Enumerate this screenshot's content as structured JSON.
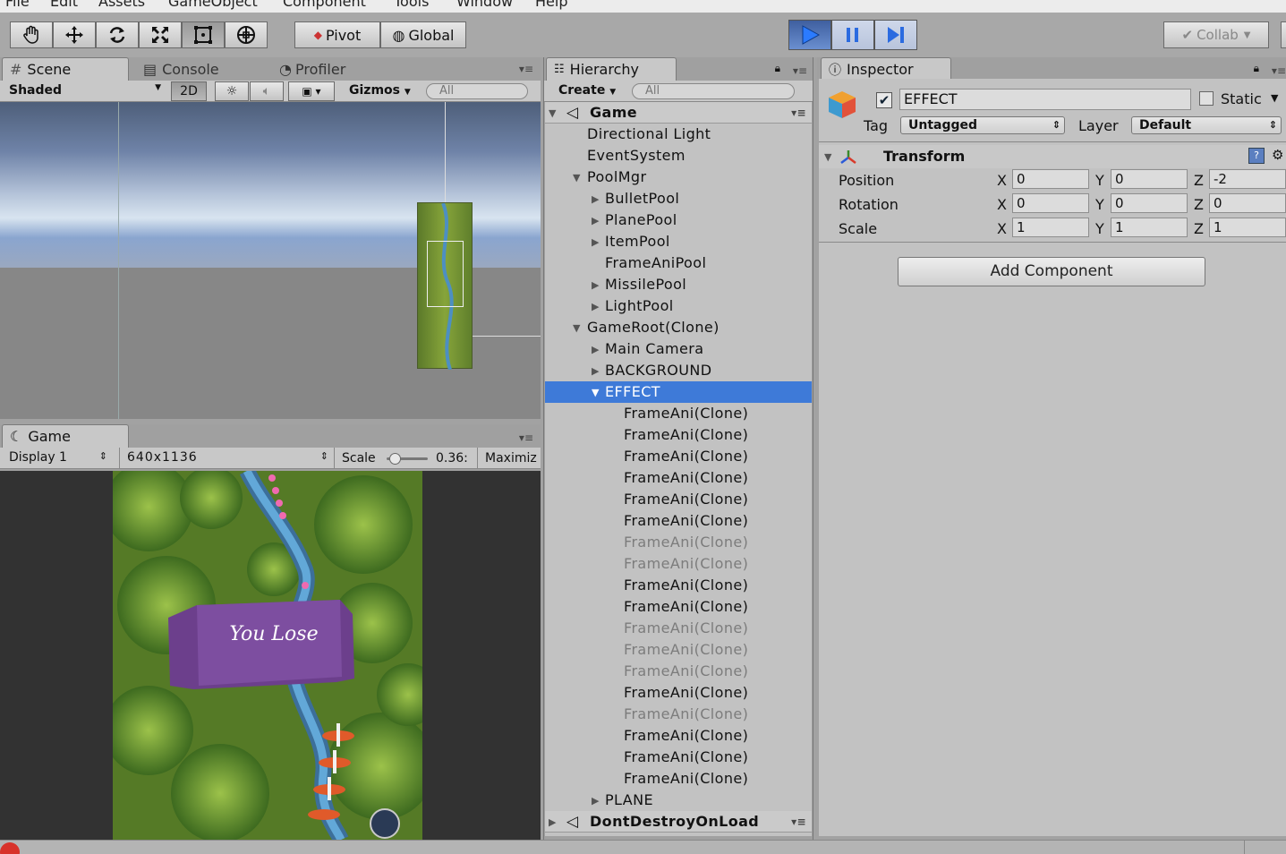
{
  "menu": [
    "File",
    "Edit",
    "Assets",
    "GameObject",
    "Component",
    "Tools",
    "Window",
    "Help"
  ],
  "toolbar": {
    "tools": [
      "hand-icon",
      "move-icon",
      "rotate-icon",
      "scale-icon",
      "rect-icon",
      "transform-icon"
    ],
    "pivot_label": "Pivot",
    "global_label": "Global",
    "collab_label": "Collab"
  },
  "scene_panel": {
    "tabs": [
      "Scene",
      "Console",
      "Profiler"
    ],
    "shading": "Shaded",
    "mode_2d": "2D",
    "gizmos": "Gizmos",
    "search_placeholder": "All"
  },
  "game_panel": {
    "tab": "Game",
    "display": "Display 1",
    "resolution": "640x1136",
    "scale_label": "Scale",
    "scale_value": "0.36:",
    "maximize": "Maximiz",
    "banner_text": "You Lose"
  },
  "hierarchy": {
    "tab": "Hierarchy",
    "create": "Create",
    "search_placeholder": "All",
    "rows": [
      {
        "label": "Game",
        "depth": 0,
        "tri": "down",
        "kind": "scene"
      },
      {
        "label": "Directional Light",
        "depth": 1,
        "tri": ""
      },
      {
        "label": "EventSystem",
        "depth": 1,
        "tri": ""
      },
      {
        "label": "PoolMgr",
        "depth": 1,
        "tri": "down"
      },
      {
        "label": "BulletPool",
        "depth": 2,
        "tri": "right"
      },
      {
        "label": "PlanePool",
        "depth": 2,
        "tri": "right"
      },
      {
        "label": "ItemPool",
        "depth": 2,
        "tri": "right"
      },
      {
        "label": "FrameAniPool",
        "depth": 2,
        "tri": ""
      },
      {
        "label": "MissilePool",
        "depth": 2,
        "tri": "right"
      },
      {
        "label": "LightPool",
        "depth": 2,
        "tri": "right"
      },
      {
        "label": "GameRoot(Clone)",
        "depth": 1,
        "tri": "down"
      },
      {
        "label": "Main Camera",
        "depth": 2,
        "tri": "right"
      },
      {
        "label": "BACKGROUND",
        "depth": 2,
        "tri": "right"
      },
      {
        "label": "EFFECT",
        "depth": 2,
        "tri": "down",
        "kind": "sel"
      },
      {
        "label": "FrameAni(Clone)",
        "depth": 3,
        "tri": ""
      },
      {
        "label": "FrameAni(Clone)",
        "depth": 3,
        "tri": ""
      },
      {
        "label": "FrameAni(Clone)",
        "depth": 3,
        "tri": ""
      },
      {
        "label": "FrameAni(Clone)",
        "depth": 3,
        "tri": ""
      },
      {
        "label": "FrameAni(Clone)",
        "depth": 3,
        "tri": ""
      },
      {
        "label": "FrameAni(Clone)",
        "depth": 3,
        "tri": ""
      },
      {
        "label": "FrameAni(Clone)",
        "depth": 3,
        "tri": "",
        "kind": "faded"
      },
      {
        "label": "FrameAni(Clone)",
        "depth": 3,
        "tri": "",
        "kind": "faded"
      },
      {
        "label": "FrameAni(Clone)",
        "depth": 3,
        "tri": ""
      },
      {
        "label": "FrameAni(Clone)",
        "depth": 3,
        "tri": ""
      },
      {
        "label": "FrameAni(Clone)",
        "depth": 3,
        "tri": "",
        "kind": "faded"
      },
      {
        "label": "FrameAni(Clone)",
        "depth": 3,
        "tri": "",
        "kind": "faded"
      },
      {
        "label": "FrameAni(Clone)",
        "depth": 3,
        "tri": "",
        "kind": "faded"
      },
      {
        "label": "FrameAni(Clone)",
        "depth": 3,
        "tri": ""
      },
      {
        "label": "FrameAni(Clone)",
        "depth": 3,
        "tri": "",
        "kind": "faded"
      },
      {
        "label": "FrameAni(Clone)",
        "depth": 3,
        "tri": ""
      },
      {
        "label": "FrameAni(Clone)",
        "depth": 3,
        "tri": ""
      },
      {
        "label": "FrameAni(Clone)",
        "depth": 3,
        "tri": ""
      },
      {
        "label": "PLANE",
        "depth": 2,
        "tri": "right"
      },
      {
        "label": "DontDestroyOnLoad",
        "depth": 0,
        "tri": "right",
        "kind": "scene"
      }
    ]
  },
  "inspector": {
    "tab": "Inspector",
    "object_name": "EFFECT",
    "active": true,
    "static_label": "Static",
    "tag_label": "Tag",
    "tag_value": "Untagged",
    "layer_label": "Layer",
    "layer_value": "Default",
    "transform_title": "Transform",
    "position_label": "Position",
    "rotation_label": "Rotation",
    "scale_label": "Scale",
    "position": {
      "x": "0",
      "y": "0",
      "z": "-2"
    },
    "rotation": {
      "x": "0",
      "y": "0",
      "z": "0"
    },
    "scale": {
      "x": "1",
      "y": "1",
      "z": "1"
    },
    "axis_x": "X",
    "axis_y": "Y",
    "axis_z": "Z",
    "add_component": "Add Component"
  },
  "colors": {
    "selection": "#3e7ad8",
    "panel": "#c2c2c2",
    "play_active": "#4a75c2"
  }
}
